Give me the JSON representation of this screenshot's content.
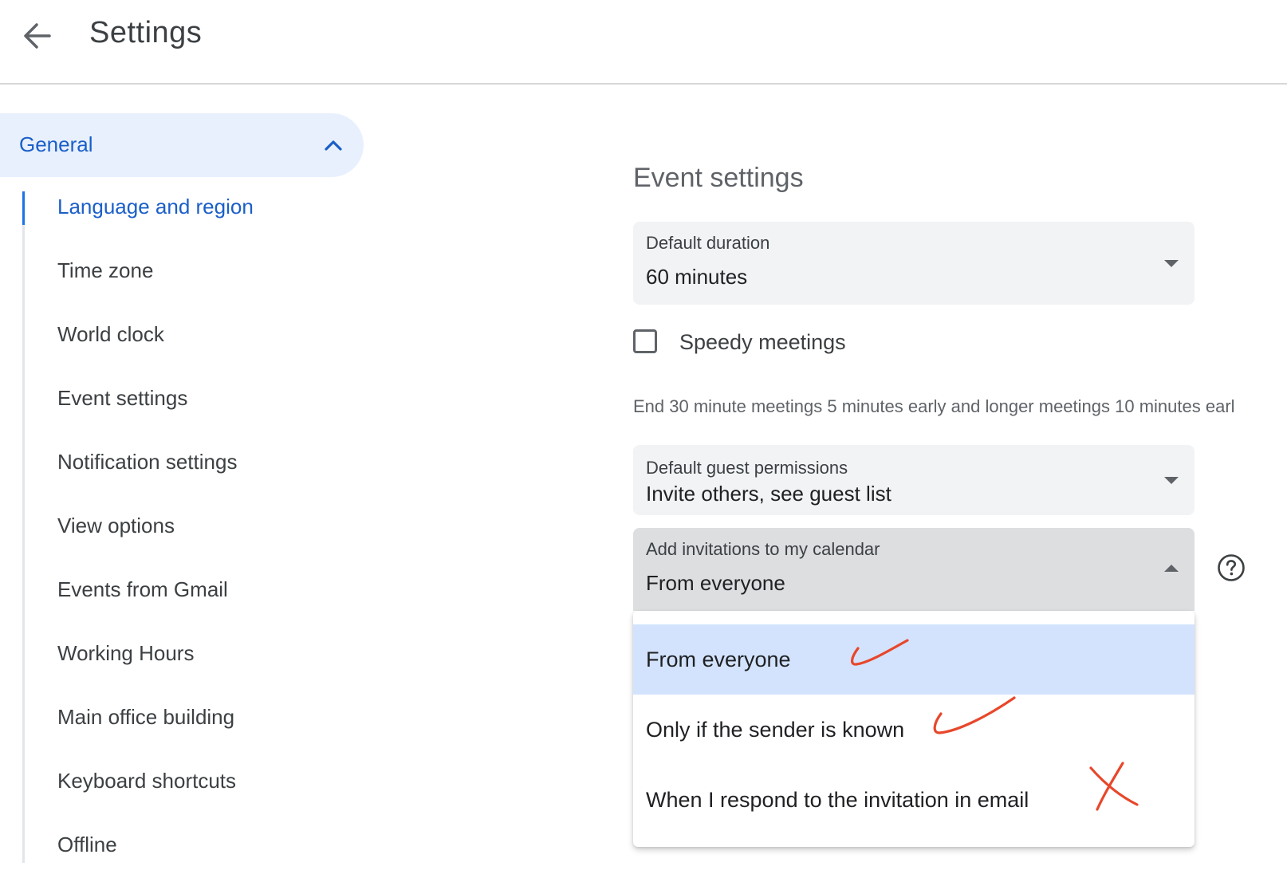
{
  "header": {
    "title": "Settings"
  },
  "sidebar": {
    "group_label": "General",
    "items": [
      {
        "label": "Language and region",
        "active": true
      },
      {
        "label": "Time zone"
      },
      {
        "label": "World clock"
      },
      {
        "label": "Event settings"
      },
      {
        "label": "Notification settings"
      },
      {
        "label": "View options"
      },
      {
        "label": "Events from Gmail"
      },
      {
        "label": "Working Hours"
      },
      {
        "label": "Main office building"
      },
      {
        "label": "Keyboard shortcuts"
      },
      {
        "label": "Offline"
      }
    ]
  },
  "main": {
    "section_title": "Event settings",
    "default_duration": {
      "label": "Default duration",
      "value": "60 minutes"
    },
    "speedy_meetings": {
      "label": "Speedy meetings",
      "checked": false,
      "hint": "End 30 minute meetings 5 minutes early and longer meetings 10 minutes earl"
    },
    "guest_permissions": {
      "label": "Default guest permissions",
      "value": "Invite others, see guest list"
    },
    "add_invitations": {
      "label": "Add invitations to my calendar",
      "value": "From everyone",
      "options": [
        {
          "label": "From everyone",
          "selected": true,
          "annotation": "check"
        },
        {
          "label": "Only if the sender is known",
          "annotation": "check"
        },
        {
          "label": "When I respond to the invitation in email",
          "annotation": "cross"
        }
      ]
    }
  },
  "colors": {
    "accent": "#1a5fc8",
    "selected_bg": "#d3e3fd",
    "annotation": "#e8472b"
  }
}
